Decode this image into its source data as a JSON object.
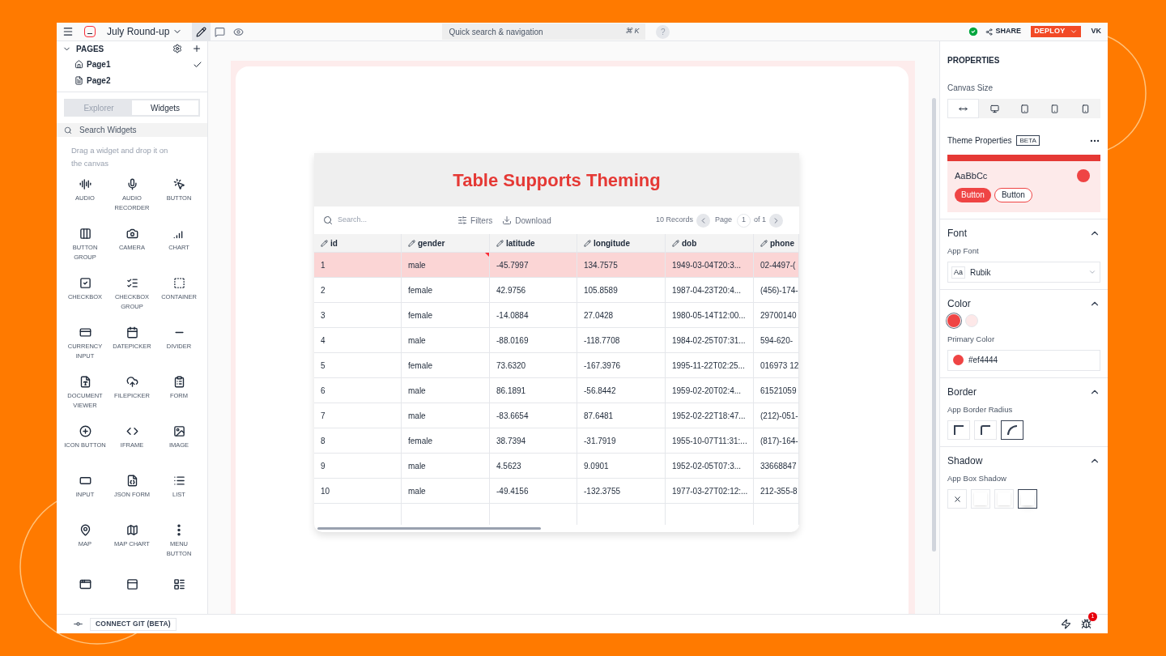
{
  "topbar": {
    "app_name": "July Round-up",
    "modes": [
      {
        "selected": true
      },
      {
        "selected": false
      },
      {
        "selected": false
      }
    ],
    "search": {
      "placeholder": "Quick search & navigation",
      "shortcut": "⌘ K"
    },
    "help": "?",
    "share": "SHARE",
    "deploy": "DEPLOY",
    "user": "VK"
  },
  "pages": {
    "title": "PAGES",
    "expanded": true,
    "items": [
      {
        "label": "Page1",
        "selected": true
      },
      {
        "label": "Page2",
        "selected": false
      }
    ]
  },
  "sidebar_tabs": [
    {
      "label": "Explorer",
      "selected": false
    },
    {
      "label": "Widgets",
      "selected": true
    }
  ],
  "widget_search": {
    "placeholder": "Search Widgets"
  },
  "widget_hint": "Drag a widget and drop it on the canvas",
  "widgets": [
    {
      "label": "AUDIO"
    },
    {
      "label": "AUDIO RECORDER"
    },
    {
      "label": "BUTTON"
    },
    {
      "label": "BUTTON GROUP"
    },
    {
      "label": "CAMERA"
    },
    {
      "label": "CHART"
    },
    {
      "label": "CHECKBOX"
    },
    {
      "label": "CHECKBOX GROUP"
    },
    {
      "label": "CONTAINER"
    },
    {
      "label": "CURRENCY INPUT"
    },
    {
      "label": "DATEPICKER"
    },
    {
      "label": "DIVIDER"
    },
    {
      "label": "DOCUMENT VIEWER"
    },
    {
      "label": "FILEPICKER"
    },
    {
      "label": "FORM"
    },
    {
      "label": "ICON BUTTON"
    },
    {
      "label": "IFRAME"
    },
    {
      "label": "IMAGE"
    },
    {
      "label": "INPUT"
    },
    {
      "label": "JSON FORM"
    },
    {
      "label": "LIST"
    },
    {
      "label": "MAP"
    },
    {
      "label": "MAP CHART"
    },
    {
      "label": "MENU BUTTON"
    },
    {
      "kind": "partial"
    },
    {
      "kind": "partial"
    },
    {
      "kind": "partial"
    }
  ],
  "table": {
    "title": "Table Supports Theming",
    "search_placeholder": "Search...",
    "filters": "Filters",
    "download": "Download",
    "records": "10 Records",
    "page_label": "Page",
    "page": "1",
    "of": "of 1",
    "columns": [
      "id",
      "gender",
      "latitude",
      "longitude",
      "dob",
      "phone"
    ],
    "rows": [
      {
        "selected": true,
        "cells": [
          "1",
          "male",
          "-45.7997",
          "134.7575",
          "1949-03-04T20:3...",
          "02-4497-("
        ]
      },
      {
        "selected": false,
        "cells": [
          "2",
          "female",
          "42.9756",
          "105.8589",
          "1987-04-23T20:4...",
          "(456)-174-"
        ]
      },
      {
        "selected": false,
        "cells": [
          "3",
          "female",
          "-14.0884",
          "27.0428",
          "1980-05-14T12:00...",
          "29700140"
        ]
      },
      {
        "selected": false,
        "cells": [
          "4",
          "male",
          "-88.0169",
          "-118.7708",
          "1984-02-25T07:31...",
          "594-620-"
        ]
      },
      {
        "selected": false,
        "cells": [
          "5",
          "female",
          "73.6320",
          "-167.3976",
          "1995-11-22T02:25...",
          "016973 12"
        ]
      },
      {
        "selected": false,
        "cells": [
          "6",
          "male",
          "86.1891",
          "-56.8442",
          "1959-02-20T02:4...",
          "61521059"
        ]
      },
      {
        "selected": false,
        "cells": [
          "7",
          "male",
          "-83.6654",
          "87.6481",
          "1952-02-22T18:47...",
          "(212)-051-"
        ]
      },
      {
        "selected": false,
        "cells": [
          "8",
          "female",
          "38.7394",
          "-31.7919",
          "1955-10-07T11:31:...",
          "(817)-164-"
        ]
      },
      {
        "selected": false,
        "cells": [
          "9",
          "male",
          "4.5623",
          "9.0901",
          "1952-02-05T07:3...",
          "33668847"
        ]
      },
      {
        "selected": false,
        "cells": [
          "10",
          "male",
          "-49.4156",
          "-132.3755",
          "1977-03-27T02:12:...",
          "212-355-8"
        ]
      }
    ]
  },
  "properties": {
    "title": "PROPERTIES",
    "canvas_size": {
      "label": "Canvas Size",
      "options": [
        {
          "selected": true
        },
        {
          "selected": false
        },
        {
          "selected": false
        },
        {
          "selected": false
        },
        {
          "selected": false
        }
      ]
    },
    "theme": {
      "label": "Theme Properties",
      "badge": "BETA",
      "sample_text": "AaBbCc",
      "buttons": [
        "Button",
        "Button"
      ]
    },
    "font": {
      "title": "Font",
      "expanded": true,
      "label": "App Font",
      "prefix": "Aa",
      "value": "Rubik"
    },
    "color": {
      "title": "Color",
      "expanded": true,
      "swatches": [
        {
          "color": "#ef4444",
          "selected": true
        },
        {
          "color": "#fde8e8",
          "selected": false
        }
      ],
      "label": "Primary Color",
      "value": "#ef4444"
    },
    "border": {
      "title": "Border",
      "expanded": true,
      "label": "App Border Radius",
      "options": [
        {
          "selected": false
        },
        {
          "selected": false
        },
        {
          "selected": true
        }
      ]
    },
    "shadow": {
      "title": "Shadow",
      "expanded": true,
      "label": "App Box Shadow",
      "options": [
        {
          "selected": false
        },
        {
          "selected": false
        },
        {
          "selected": false
        },
        {
          "selected": true
        }
      ]
    }
  },
  "bottombar": {
    "git": "CONNECT GIT (BETA)",
    "bug_count": "1"
  }
}
